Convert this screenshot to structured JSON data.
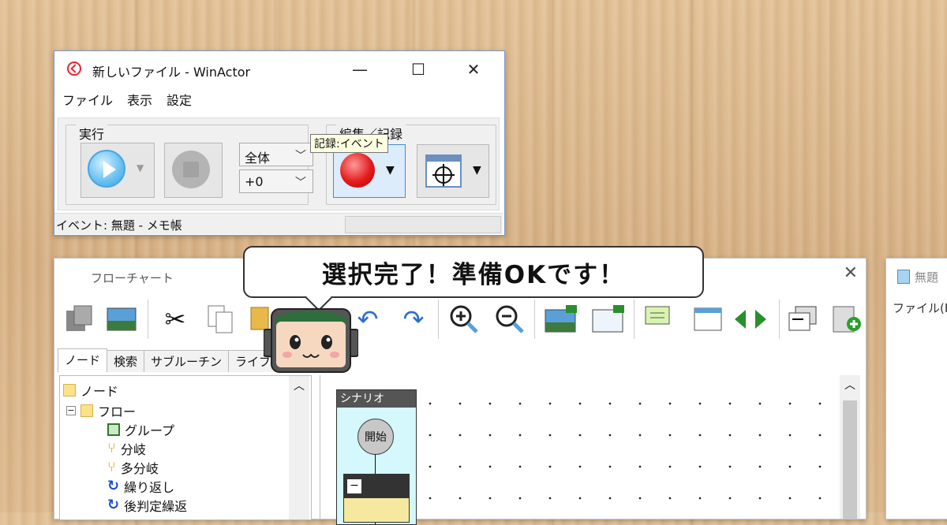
{
  "main_window": {
    "title": "新しいファイル - WinActor",
    "controls": {
      "minimize": "—",
      "maximize": "☐",
      "close": "✕"
    },
    "menu": [
      "ファイル",
      "表示",
      "設定"
    ],
    "run_group": {
      "label": "実行",
      "scope_select": "全体",
      "offset_select": "+0"
    },
    "edit_group": {
      "label": "編集／記録"
    },
    "tooltip": "記録:イベント",
    "status_text": "イベント: 無題 - メモ帳"
  },
  "speech_bubble": "選択完了！準備OKです！",
  "flowchart_window": {
    "title": "フローチャート",
    "close": "✕",
    "tabs": [
      "ノード",
      "検索",
      "サブルーチン",
      "ライブ"
    ],
    "tree": [
      {
        "label": "ノード",
        "icon": "folder-icon"
      },
      {
        "label": "フロー",
        "icon": "folder-icon"
      },
      {
        "label": "グループ",
        "icon": "group-node-icon"
      },
      {
        "label": "分岐",
        "icon": "branch-icon"
      },
      {
        "label": "多分岐",
        "icon": "multi-branch-icon"
      },
      {
        "label": "繰り返し",
        "icon": "loop-icon"
      },
      {
        "label": "後判定繰返",
        "icon": "post-loop-icon"
      }
    ],
    "scenario": {
      "header": "シナリオ",
      "start_node": "開始",
      "group_minus": "−"
    }
  },
  "side_window": {
    "title": "無題",
    "menu_partial": "ファイル(F"
  },
  "colors": {
    "accent_border": "#7a9cc6",
    "record_red": "#e31b1b",
    "play_blue": "#66bff2",
    "tooltip_bg": "#ffffe1"
  }
}
